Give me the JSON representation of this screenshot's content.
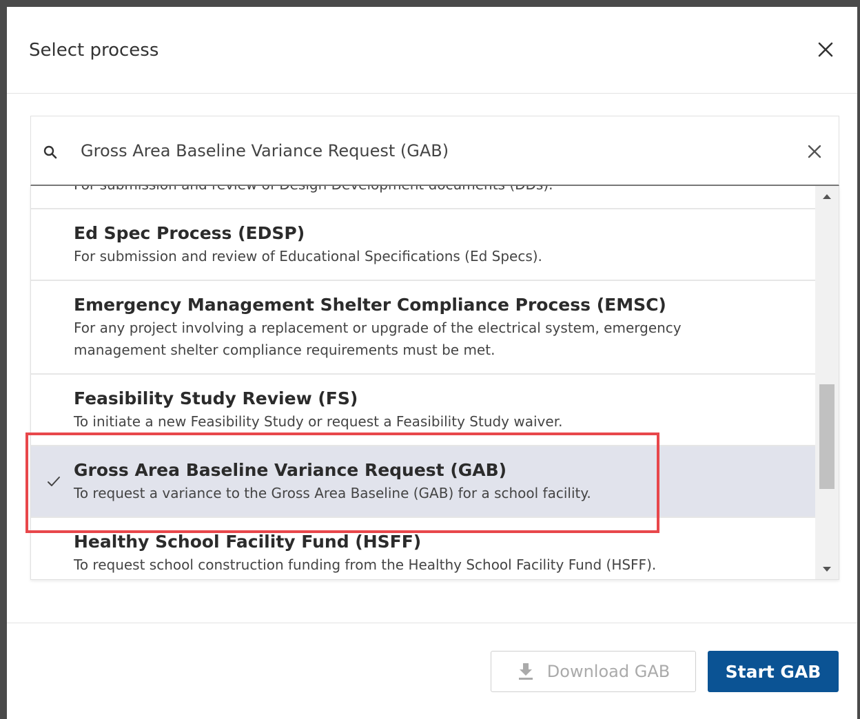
{
  "dialog": {
    "title": "Select process"
  },
  "search": {
    "value": "Gross Area Baseline Variance Request (GAB)",
    "placeholder": ""
  },
  "processes": [
    {
      "name": "",
      "description": "For submission and review of Design Development documents (DDs).",
      "selected": false
    },
    {
      "name": "Ed Spec Process (EDSP)",
      "description": "For submission and review of Educational Specifications (Ed Specs).",
      "selected": false
    },
    {
      "name": "Emergency Management Shelter Compliance Process (EMSC)",
      "description": "For any project involving a replacement or upgrade of the electrical system, emergency management shelter compliance requirements must be met.",
      "selected": false
    },
    {
      "name": "Feasibility Study Review (FS)",
      "description": "To initiate a new Feasibility Study or request a Feasibility Study waiver.",
      "selected": false
    },
    {
      "name": "Gross Area Baseline Variance Request (GAB)",
      "description": "To request a variance to the Gross Area Baseline (GAB) for a school facility.",
      "selected": true
    },
    {
      "name": "Healthy School Facility Fund (HSFF)",
      "description": "To request school construction funding from the Healthy School Facility Fund (HSFF).",
      "selected": false
    }
  ],
  "footer": {
    "download_label": "Download GAB",
    "start_label": "Start GAB"
  },
  "colors": {
    "primary": "#0b5394",
    "selected_row": "#e1e3ec",
    "highlight": "#e8474b"
  }
}
